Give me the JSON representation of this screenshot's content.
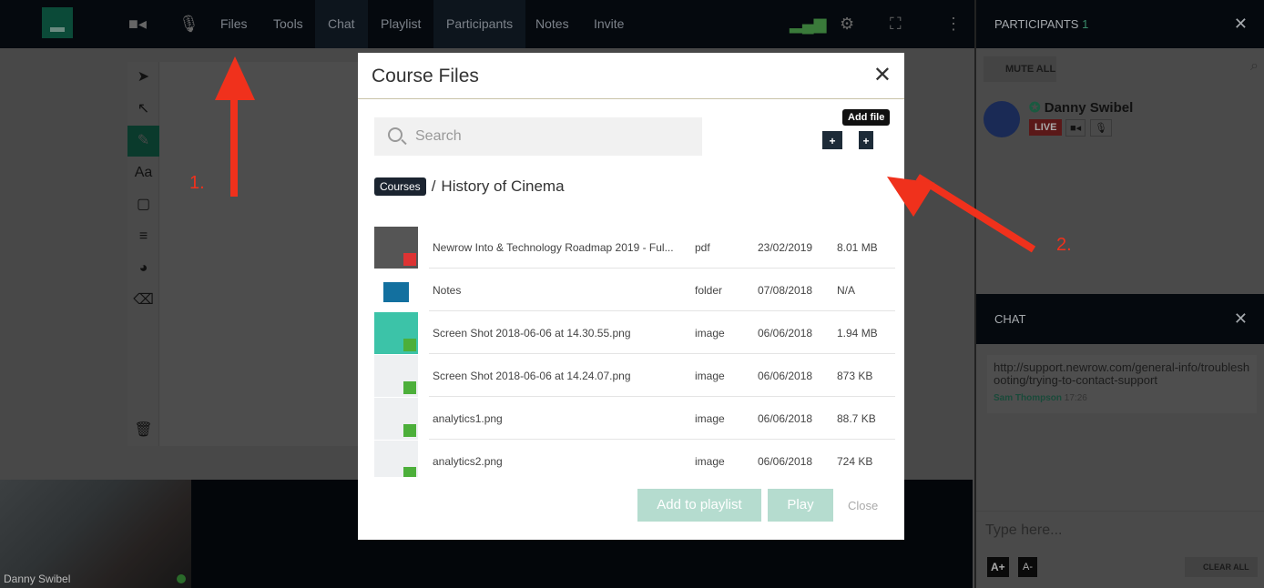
{
  "topbar": {
    "nav": [
      "Files",
      "Tools",
      "Chat",
      "Playlist",
      "Participants",
      "Notes",
      "Invite"
    ]
  },
  "participants": {
    "title": "PARTICIPANTS",
    "count": "1",
    "mute_all": "MUTE ALL",
    "user": {
      "name": "Danny Swibel",
      "status": "LIVE"
    }
  },
  "chat": {
    "title": "CHAT",
    "message": "http://support.newrow.com/general-info/troubleshooting/trying-to-contact-support",
    "author": "Sam Thompson",
    "time": "17:26",
    "placeholder": "Type here...",
    "font_up": "A+",
    "font_down": "A-",
    "clear_all": "CLEAR ALL"
  },
  "video": {
    "name": "Danny Swibel"
  },
  "modal": {
    "title": "Course Files",
    "search_placeholder": "Search",
    "tooltip": "Add file",
    "breadcrumb_root": "Courses",
    "breadcrumb_current": "History of Cinema",
    "files": [
      {
        "name": "Newrow Into & Technology Roadmap 2019 - Ful...",
        "type": "pdf",
        "date": "23/02/2019",
        "size": "8.01 MB"
      },
      {
        "name": "Notes",
        "type": "folder",
        "date": "07/08/2018",
        "size": "N/A"
      },
      {
        "name": "Screen Shot 2018-06-06 at 14.30.55.png",
        "type": "image",
        "date": "06/06/2018",
        "size": "1.94 MB"
      },
      {
        "name": "Screen Shot 2018-06-06 at 14.24.07.png",
        "type": "image",
        "date": "06/06/2018",
        "size": "873 KB"
      },
      {
        "name": "analytics1.png",
        "type": "image",
        "date": "06/06/2018",
        "size": "88.7 KB"
      },
      {
        "name": "analytics2.png",
        "type": "image",
        "date": "06/06/2018",
        "size": "724 KB"
      }
    ],
    "add_to_playlist": "Add to playlist",
    "play": "Play",
    "close": "Close"
  },
  "annotations": [
    "1.",
    "2."
  ],
  "colors": {
    "accent": "#1f8a6a",
    "arrow": "#f0311c",
    "live": "#c62828"
  }
}
